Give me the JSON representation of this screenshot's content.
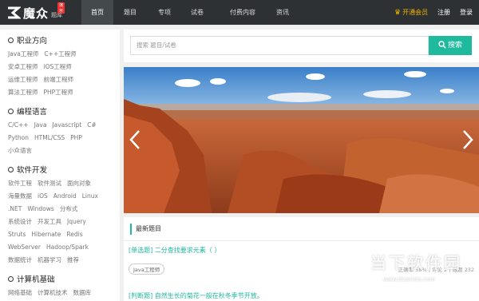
{
  "nav": {
    "logo_text": "魔众",
    "logo_sub": "题库",
    "logo_badge": "演示",
    "items": [
      {
        "label": "首页",
        "active": true
      },
      {
        "label": "题目",
        "active": false
      },
      {
        "label": "专项",
        "active": false
      },
      {
        "label": "试卷",
        "active": false
      },
      {
        "label": "付费内容",
        "active": false
      },
      {
        "label": "资讯",
        "active": false
      }
    ],
    "vip": "开通会员",
    "register": "注册",
    "login": "登录"
  },
  "sidebar": {
    "sections": [
      {
        "title": "职业方向",
        "lines": [
          [
            "Java工程师",
            "C++工程师"
          ],
          [
            "安卓工程师",
            "iOS工程师"
          ],
          [
            "运维工程师",
            "前端工程师"
          ],
          [
            "算法工程师",
            "PHP工程师"
          ]
        ]
      },
      {
        "title": "编程语言",
        "lines": [
          [
            "C/C++",
            "Java",
            "Javascript",
            "C#"
          ],
          [
            "Python",
            "HTML/CSS",
            "PHP"
          ],
          [
            "小众语言"
          ]
        ]
      },
      {
        "title": "软件开发",
        "lines": [
          [
            "软件工程",
            "软件测试",
            "面向对象"
          ],
          [
            "海量数据",
            "iOS",
            "Android",
            "Linux"
          ],
          [
            ".NET",
            "Windows",
            "分布式"
          ],
          [
            "系统设计",
            "开发工具",
            "Jquery"
          ],
          [
            "Struts",
            "Hibernate",
            "Redis"
          ],
          [
            "WebServer",
            "Hadoop/Spark"
          ],
          [
            "数据统计",
            "机器学习",
            "推荐"
          ]
        ]
      },
      {
        "title": "计算机基础",
        "lines": [
          [
            "网络基础",
            "计算机技术",
            "数据库"
          ]
        ]
      }
    ]
  },
  "search": {
    "placeholder": "搜索 题目/试卷",
    "button": "搜索"
  },
  "questions": {
    "header": "最新题目",
    "items": [
      {
        "text": "[单选题] 二分查找要求元素（ ）",
        "tag": "Java工程师",
        "meta": "正确率 58% | 评论 2 | 做题 232"
      },
      {
        "text": "[判断题] 自然生长的菊花一般在秋冬季节开放。"
      }
    ]
  },
  "watermark": {
    "cn": "当下软件园",
    "url": "www.downxia.com"
  },
  "colors": {
    "nav_bg": "#2e3133",
    "accent": "#1fb99d",
    "vip": "#f4b400"
  }
}
